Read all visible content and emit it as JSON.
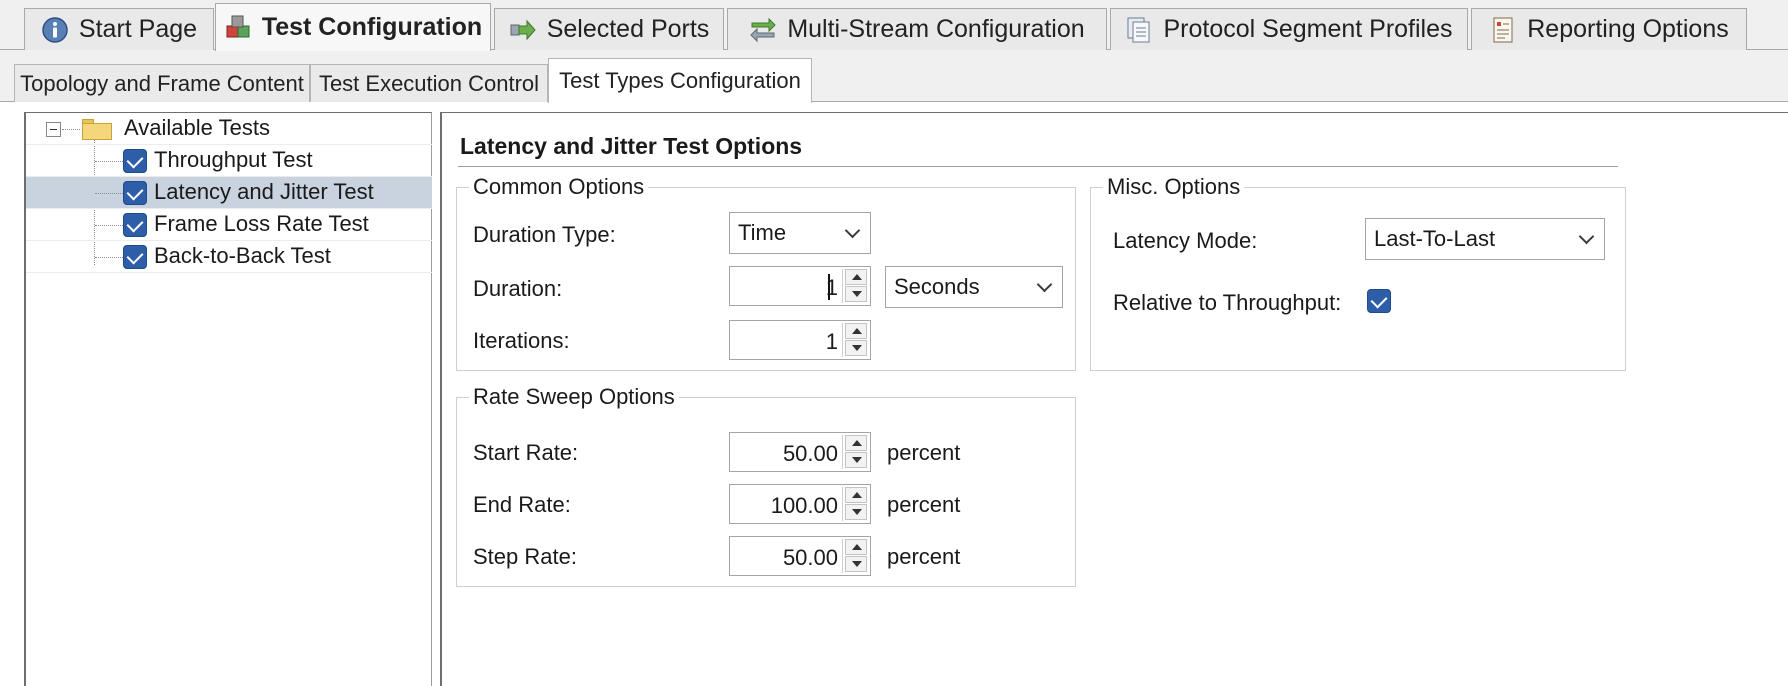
{
  "main_tabs": [
    {
      "label": "Start Page",
      "icon": "info-icon"
    },
    {
      "label": "Test Configuration",
      "icon": "cubes-icon",
      "active": true
    },
    {
      "label": "Selected Ports",
      "icon": "ports-arrow-icon"
    },
    {
      "label": "Multi-Stream Configuration",
      "icon": "multistream-icon"
    },
    {
      "label": "Protocol Segment Profiles",
      "icon": "document-stack-icon"
    },
    {
      "label": "Reporting Options",
      "icon": "report-icon"
    }
  ],
  "sub_tabs": [
    {
      "label": "Topology and Frame Content"
    },
    {
      "label": "Test Execution Control"
    },
    {
      "label": "Test Types Configuration",
      "active": true
    }
  ],
  "tree": {
    "root_label": "Available Tests",
    "items": [
      {
        "label": "Throughput Test",
        "checked": true
      },
      {
        "label": "Latency and Jitter Test",
        "checked": true,
        "selected": true
      },
      {
        "label": "Frame Loss Rate Test",
        "checked": true
      },
      {
        "label": "Back-to-Back Test",
        "checked": true
      }
    ]
  },
  "options": {
    "title": "Latency and Jitter Test Options",
    "common": {
      "caption": "Common Options",
      "duration_type_label": "Duration Type:",
      "duration_type_value": "Time",
      "duration_label": "Duration:",
      "duration_value": "1",
      "duration_unit": "Seconds",
      "iterations_label": "Iterations:",
      "iterations_value": "1"
    },
    "misc": {
      "caption": "Misc. Options",
      "latency_mode_label": "Latency Mode:",
      "latency_mode_value": "Last-To-Last",
      "relative_label": "Relative to Throughput:",
      "relative_checked": true
    },
    "rate_sweep": {
      "caption": "Rate Sweep Options",
      "start_label": "Start Rate:",
      "start_value": "50.00",
      "end_label": "End Rate:",
      "end_value": "100.00",
      "step_label": "Step Rate:",
      "step_value": "50.00",
      "unit": "percent"
    }
  },
  "colors": {
    "checkbox": "#2e5ea8",
    "selection": "#c9d3df",
    "tab_strip": "#f0f0f0"
  }
}
